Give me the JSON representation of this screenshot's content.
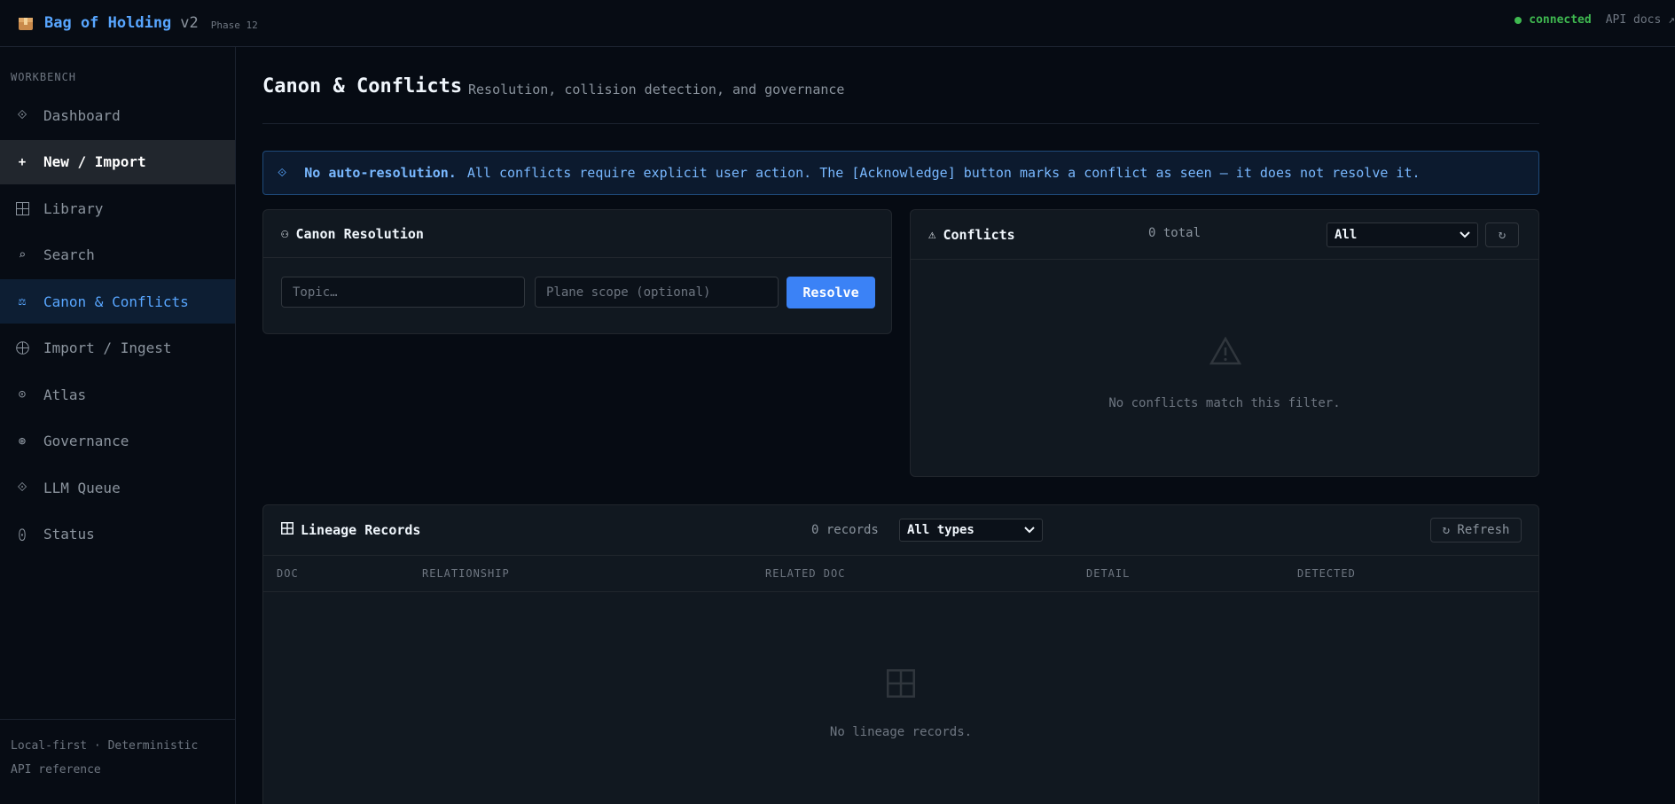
{
  "topbar": {
    "brand_name": "Bag of Holding",
    "version": "v2",
    "phase": "Phase 12",
    "status": "connected",
    "api_docs": "API docs ↗"
  },
  "sidebar": {
    "section_label": "WORKBENCH",
    "items": [
      {
        "label": "Dashboard",
        "icon": "diamond-icon"
      },
      {
        "label": "New / Import",
        "icon": "plus-icon"
      },
      {
        "label": "Library",
        "icon": "grid-icon"
      },
      {
        "label": "Search",
        "icon": "search-icon"
      },
      {
        "label": "Canon & Conflicts",
        "icon": "scales-icon"
      },
      {
        "label": "Import / Ingest",
        "icon": "globe-icon"
      },
      {
        "label": "Atlas",
        "icon": "target-icon"
      },
      {
        "label": "Governance",
        "icon": "gear-icon"
      },
      {
        "label": "LLM Queue",
        "icon": "diamond-icon"
      },
      {
        "label": "Status",
        "icon": "status-dot-icon"
      }
    ],
    "footer_line1": "Local-first · Deterministic",
    "footer_line2": "API reference"
  },
  "page": {
    "title": "Canon & Conflicts",
    "subtitle": "Resolution, collision detection, and governance"
  },
  "banner": {
    "strong": "No auto-resolution.",
    "text": "All conflicts require explicit user action. The [Acknowledge] button marks a conflict as seen — it does not resolve it."
  },
  "canon": {
    "title": "Canon Resolution",
    "topic_placeholder": "Topic…",
    "scope_placeholder": "Plane scope (optional)",
    "resolve_label": "Resolve"
  },
  "conflicts": {
    "title": "Conflicts",
    "count": "0 total",
    "filter": "All",
    "refresh_label": "↻",
    "empty": "No conflicts match this filter."
  },
  "lineage": {
    "title": "Lineage Records",
    "count": "0 records",
    "filter": "All types",
    "refresh_label": "↻ Refresh",
    "columns": [
      "DOC",
      "RELATIONSHIP",
      "RELATED DOC",
      "DETAIL",
      "DETECTED"
    ],
    "empty": "No lineage records."
  },
  "colors": {
    "accent": "#3b82f6",
    "link": "#58a6ff",
    "connected": "#3fb950",
    "background": "#060b13",
    "panel": "#111820"
  }
}
